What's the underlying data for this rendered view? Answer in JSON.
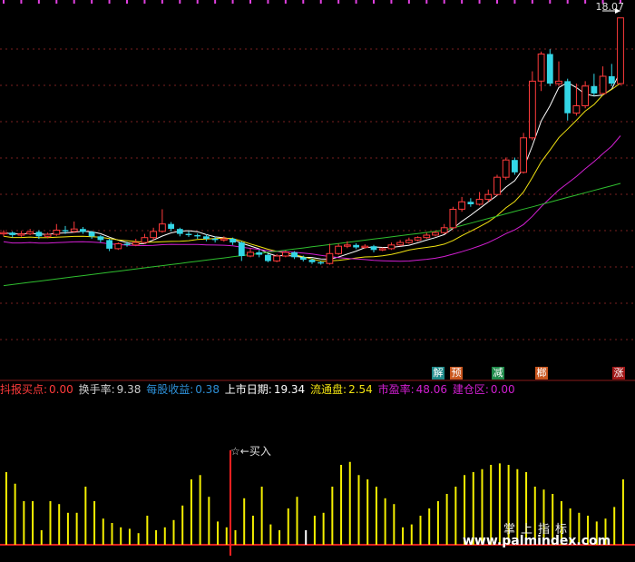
{
  "colors": {
    "background": "#000000",
    "up": "#ff3b3b",
    "down": "#33d6e6",
    "ma_white": "#ffffff",
    "ma_yellow": "#f2e311",
    "ma_magenta": "#d21fd2",
    "ma_green": "#2fbf2f",
    "volume_yellow": "#f5f000"
  },
  "price": {
    "high_label": "18.07",
    "arrow": "←"
  },
  "info_bar": {
    "item1_label": "抖报买点:",
    "item1_value": "0.00",
    "item2_label": "换手率:",
    "item2_value": "9.38",
    "item3_label": "每股收益:",
    "item3_value": "0.38",
    "item4_label": "上市日期:",
    "item4_value": "19.34",
    "item5_label": "流通盘:",
    "item5_value": "2.54",
    "item6_label": "市盈率:",
    "item6_value": "48.06",
    "item7_label": "建仓区:",
    "item7_value": "0.00"
  },
  "badges": [
    {
      "text": "解",
      "color": "#1f8a8a"
    },
    {
      "text": "预",
      "color": "#c9561e"
    },
    {
      "text": "减",
      "color": "#1f8a4a"
    },
    {
      "text": "榔",
      "color": "#c9561e"
    },
    {
      "text": "涨",
      "color": "#a01818"
    }
  ],
  "buy_signal": "☆←买入",
  "watermark": {
    "cn": "掌上指标",
    "url": "www.palmindex.com"
  },
  "chart_data": {
    "type": "candlestick",
    "candles": [
      [
        9.3,
        9.35,
        9.45,
        9.2
      ],
      [
        9.35,
        9.25,
        9.4,
        9.15
      ],
      [
        9.25,
        9.3,
        9.42,
        9.18
      ],
      [
        9.3,
        9.38,
        9.5,
        9.25
      ],
      [
        9.38,
        9.2,
        9.45,
        9.1
      ],
      [
        9.2,
        9.28,
        9.35,
        9.12
      ],
      [
        9.28,
        9.45,
        9.7,
        9.22
      ],
      [
        9.45,
        9.4,
        9.62,
        9.3
      ],
      [
        9.4,
        9.5,
        9.8,
        9.35
      ],
      [
        9.5,
        9.38,
        9.58,
        9.3
      ],
      [
        9.38,
        9.2,
        9.42,
        9.1
      ],
      [
        9.2,
        9.05,
        9.25,
        8.95
      ],
      [
        9.05,
        8.7,
        9.1,
        8.6
      ],
      [
        8.7,
        8.9,
        8.95,
        8.65
      ],
      [
        8.9,
        8.85,
        8.98,
        8.78
      ],
      [
        8.85,
        8.95,
        9.1,
        8.8
      ],
      [
        8.95,
        9.15,
        9.3,
        8.9
      ],
      [
        9.15,
        9.4,
        9.55,
        9.05
      ],
      [
        9.4,
        9.7,
        10.3,
        9.35
      ],
      [
        9.7,
        9.5,
        9.78,
        9.4
      ],
      [
        9.5,
        9.3,
        9.55,
        9.2
      ],
      [
        9.3,
        9.25,
        9.4,
        9.18
      ],
      [
        9.25,
        9.2,
        9.32,
        9.1
      ],
      [
        9.2,
        9.1,
        9.28,
        9.0
      ],
      [
        9.1,
        9.05,
        9.2,
        8.95
      ],
      [
        9.05,
        9.1,
        9.2,
        8.98
      ],
      [
        9.1,
        8.95,
        9.15,
        8.85
      ],
      [
        8.95,
        8.4,
        9.0,
        8.2
      ],
      [
        8.4,
        8.55,
        8.7,
        8.35
      ],
      [
        8.55,
        8.45,
        8.65,
        8.35
      ],
      [
        8.45,
        8.2,
        8.5,
        8.15
      ],
      [
        8.2,
        8.4,
        8.48,
        8.15
      ],
      [
        8.4,
        8.55,
        8.62,
        8.35
      ],
      [
        8.55,
        8.35,
        8.6,
        8.28
      ],
      [
        8.35,
        8.25,
        8.42,
        8.18
      ],
      [
        8.25,
        8.15,
        8.3,
        8.08
      ],
      [
        8.15,
        8.1,
        8.2,
        8.05
      ],
      [
        8.1,
        8.5,
        8.9,
        8.05
      ],
      [
        8.5,
        8.8,
        8.9,
        8.45
      ],
      [
        8.8,
        8.85,
        9.0,
        8.72
      ],
      [
        8.85,
        8.75,
        8.92,
        8.68
      ],
      [
        8.75,
        8.8,
        8.88,
        8.7
      ],
      [
        8.8,
        8.65,
        8.85,
        8.55
      ],
      [
        8.65,
        8.7,
        8.75,
        8.6
      ],
      [
        8.7,
        8.85,
        8.95,
        8.65
      ],
      [
        8.85,
        8.95,
        9.05,
        8.8
      ],
      [
        8.95,
        9.05,
        9.15,
        8.9
      ],
      [
        9.05,
        9.15,
        9.2,
        9.0
      ],
      [
        9.15,
        9.25,
        9.35,
        9.1
      ],
      [
        9.25,
        9.35,
        9.42,
        9.2
      ],
      [
        9.35,
        9.55,
        9.7,
        9.3
      ],
      [
        9.55,
        10.3,
        10.4,
        9.5
      ],
      [
        10.3,
        10.6,
        10.8,
        10.2
      ],
      [
        10.6,
        10.5,
        10.75,
        10.4
      ],
      [
        10.5,
        10.7,
        11.0,
        10.45
      ],
      [
        10.7,
        10.9,
        11.1,
        10.6
      ],
      [
        10.9,
        11.6,
        11.7,
        10.85
      ],
      [
        11.6,
        12.3,
        12.4,
        11.5
      ],
      [
        12.3,
        11.8,
        12.4,
        11.7
      ],
      [
        11.8,
        13.2,
        13.4,
        11.75
      ],
      [
        13.2,
        15.5,
        15.9,
        13.1
      ],
      [
        15.5,
        16.6,
        16.7,
        15.1
      ],
      [
        16.6,
        15.4,
        16.8,
        15.3
      ],
      [
        15.4,
        15.5,
        16.3,
        15.3
      ],
      [
        15.5,
        14.2,
        15.6,
        13.9
      ],
      [
        14.2,
        14.5,
        15.4,
        14.1
      ],
      [
        14.5,
        15.3,
        15.5,
        14.4
      ],
      [
        15.3,
        15.0,
        15.8,
        14.9
      ],
      [
        15.0,
        15.7,
        16.1,
        14.95
      ],
      [
        15.7,
        15.4,
        16.2,
        15.3
      ],
      [
        15.4,
        18.07,
        18.07,
        15.35
      ]
    ],
    "volume": [
      0.5,
      0.42,
      0.3,
      0.3,
      0.1,
      0.3,
      0.28,
      0.22,
      0.22,
      0.4,
      0.3,
      0.18,
      0.15,
      0.12,
      0.11,
      0.08,
      0.2,
      0.1,
      0.12,
      0.17,
      0.27,
      0.45,
      0.48,
      0.33,
      0.16,
      0.12,
      0.1,
      0.32,
      0.2,
      0.4,
      0.14,
      0.1,
      0.25,
      0.33,
      0.1,
      0.2,
      0.22,
      0.4,
      0.55,
      0.57,
      0.48,
      0.45,
      0.4,
      0.32,
      0.28,
      0.12,
      0.14,
      0.2,
      0.25,
      0.3,
      0.35,
      0.4,
      0.48,
      0.5,
      0.52,
      0.55,
      0.56,
      0.55,
      0.52,
      0.5,
      0.4,
      0.38,
      0.35,
      0.3,
      0.25,
      0.22,
      0.2,
      0.16,
      0.18,
      0.26,
      0.45
    ],
    "ylim": [
      7.0,
      18.5
    ]
  }
}
